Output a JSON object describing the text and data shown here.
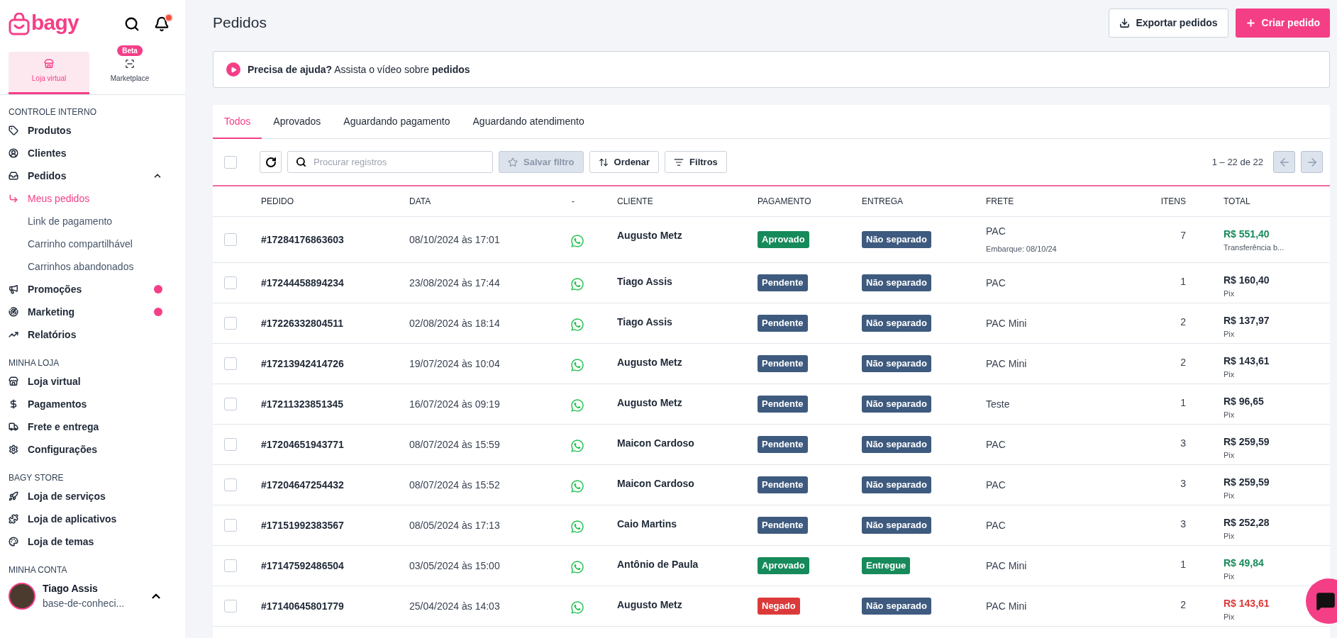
{
  "sidebar": {
    "logo": "bagy",
    "notification_dot": true,
    "modes": [
      {
        "label": "Loja virtual",
        "selected": true,
        "kind": "store"
      },
      {
        "label": "Marketplace",
        "selected": false,
        "kind": "marketplace",
        "badge": "Beta"
      }
    ],
    "sections": [
      {
        "title": "CONTROLE INTERNO",
        "items": [
          {
            "label": "Produtos",
            "dot": false
          },
          {
            "label": "Clientes",
            "dot": false
          },
          {
            "label": "Pedidos",
            "dot": false,
            "expanded": true,
            "children": [
              {
                "label": "Meus pedidos",
                "selected": true
              },
              {
                "label": "Link de pagamento",
                "selected": false
              },
              {
                "label": "Carrinho compartilhável",
                "selected": false
              },
              {
                "label": "Carrinhos abandonados",
                "selected": false
              }
            ]
          },
          {
            "label": "Promoções",
            "dot": true
          },
          {
            "label": "Marketing",
            "dot": true
          },
          {
            "label": "Relatórios",
            "dot": false
          }
        ]
      },
      {
        "title": "MINHA LOJA",
        "items": [
          {
            "label": "Loja virtual",
            "dot": false
          },
          {
            "label": "Pagamentos",
            "dot": false
          },
          {
            "label": "Frete e entrega",
            "dot": false
          },
          {
            "label": "Configurações",
            "dot": false
          }
        ]
      },
      {
        "title": "BAGY STORE",
        "items": [
          {
            "label": "Loja de serviços",
            "dot": false
          },
          {
            "label": "Loja de aplicativos",
            "dot": false
          },
          {
            "label": "Loja de temas",
            "dot": false
          }
        ]
      }
    ],
    "account": {
      "title": "MINHA CONTA",
      "name": "Tiago Assis",
      "store": "base-de-conheci..."
    }
  },
  "page": {
    "title": "Pedidos",
    "buttons": [
      {
        "label": "Exportar pedidos",
        "kind": "secondary"
      },
      {
        "label": "Criar pedido",
        "kind": "primary"
      }
    ],
    "help": "**Precisa de ajuda?** Assista o vídeo sobre **pedidos**"
  },
  "tabs": [
    {
      "label": "Todos",
      "selected": true
    },
    {
      "label": "Aprovados",
      "selected": false
    },
    {
      "label": "Aguardando pagamento",
      "selected": false
    },
    {
      "label": "Aguardando atendimento",
      "selected": false
    }
  ],
  "toolbar": {
    "select_all": false,
    "search": {
      "placeholder": "Procurar registros"
    },
    "save_filter": {
      "label": "Salvar filtro",
      "disabled": true
    },
    "sort": "Ordenar",
    "filters": "Filtros",
    "pagination": "1 – 22 de 22",
    "prev_disabled": true,
    "next_disabled": true
  },
  "table": {
    "columns": [
      "PEDIDO",
      "DATA",
      "-",
      "CLIENTE",
      "PAGAMENTO",
      "ENTREGA",
      "FRETE",
      "ITENS",
      "TOTAL"
    ],
    "rows": [
      {
        "checked": false,
        "id": "#17284176863603",
        "date": "08/10/2024 às 17:01",
        "client": "Augusto Metz",
        "payment": {
          "label": "Aprovado",
          "kind": "approved"
        },
        "delivery": {
          "label": "Não separado",
          "kind": "pending"
        },
        "shipping": "PAC",
        "shipping_note": "Embarque: 08/10/24",
        "items": "7",
        "total": "R$ 551,40",
        "method": "Transferência b..."
      },
      {
        "checked": false,
        "id": "#17244458894234",
        "date": "23/08/2024 às 17:44",
        "client": "Tiago Assis",
        "payment": {
          "label": "Pendente",
          "kind": "pending"
        },
        "delivery": {
          "label": "Não separado",
          "kind": "pending"
        },
        "shipping": "PAC",
        "items": "1",
        "total": "R$ 160,40",
        "method": "Pix"
      },
      {
        "checked": false,
        "id": "#17226332804511",
        "date": "02/08/2024 às 18:14",
        "client": "Tiago Assis",
        "payment": {
          "label": "Pendente",
          "kind": "pending"
        },
        "delivery": {
          "label": "Não separado",
          "kind": "pending"
        },
        "shipping": "PAC Mini",
        "items": "2",
        "total": "R$ 137,97",
        "method": "Pix"
      },
      {
        "checked": false,
        "id": "#17213942414726",
        "date": "19/07/2024 às 10:04",
        "client": "Augusto Metz",
        "payment": {
          "label": "Pendente",
          "kind": "pending"
        },
        "delivery": {
          "label": "Não separado",
          "kind": "pending"
        },
        "shipping": "PAC Mini",
        "items": "2",
        "total": "R$ 143,61",
        "method": "Pix"
      },
      {
        "checked": false,
        "id": "#17211323851345",
        "date": "16/07/2024 às 09:19",
        "client": "Augusto Metz",
        "payment": {
          "label": "Pendente",
          "kind": "pending"
        },
        "delivery": {
          "label": "Não separado",
          "kind": "pending"
        },
        "shipping": "Teste",
        "items": "1",
        "total": "R$ 96,65",
        "method": "Pix"
      },
      {
        "checked": false,
        "id": "#17204651943771",
        "date": "08/07/2024 às 15:59",
        "client": "Maicon Cardoso",
        "payment": {
          "label": "Pendente",
          "kind": "pending"
        },
        "delivery": {
          "label": "Não separado",
          "kind": "pending"
        },
        "shipping": "PAC",
        "items": "3",
        "total": "R$ 259,59",
        "method": "Pix"
      },
      {
        "checked": false,
        "id": "#17204647254432",
        "date": "08/07/2024 às 15:52",
        "client": "Maicon Cardoso",
        "payment": {
          "label": "Pendente",
          "kind": "pending"
        },
        "delivery": {
          "label": "Não separado",
          "kind": "pending"
        },
        "shipping": "PAC",
        "items": "3",
        "total": "R$ 259,59",
        "method": "Pix"
      },
      {
        "checked": false,
        "id": "#17151992383567",
        "date": "08/05/2024 às 17:13",
        "client": "Caio Martins",
        "payment": {
          "label": "Pendente",
          "kind": "pending"
        },
        "delivery": {
          "label": "Não separado",
          "kind": "pending"
        },
        "shipping": "PAC",
        "items": "3",
        "total": "R$ 252,28",
        "method": "Pix"
      },
      {
        "checked": false,
        "id": "#17147592486504",
        "date": "03/05/2024 às 15:00",
        "client": "Antônio de Paula",
        "payment": {
          "label": "Aprovado",
          "kind": "approved"
        },
        "delivery": {
          "label": "Entregue",
          "kind": "approved"
        },
        "shipping": "PAC Mini",
        "items": "1",
        "total": "R$ 49,84",
        "method": "Pix"
      },
      {
        "checked": false,
        "id": "#17140645801779",
        "date": "25/04/2024 às 14:03",
        "client": "Augusto Metz",
        "payment": {
          "label": "Negado",
          "kind": "denied"
        },
        "delivery": {
          "label": "Não separado",
          "kind": "pending"
        },
        "shipping": "PAC Mini",
        "items": "2",
        "total": "R$ 143,61",
        "method": "Pix"
      }
    ]
  }
}
